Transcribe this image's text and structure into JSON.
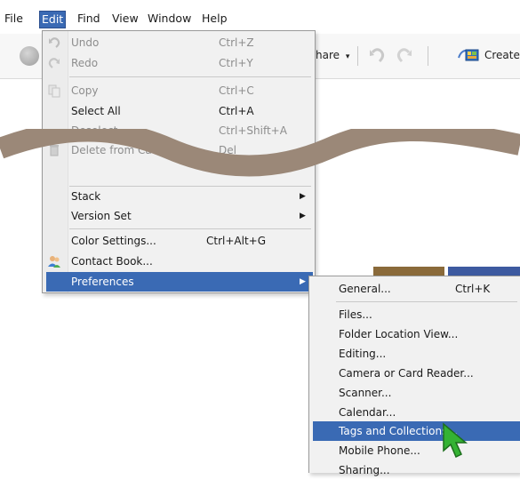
{
  "menubar": {
    "items": [
      "File",
      "Edit",
      "Find",
      "View",
      "Window",
      "Help"
    ],
    "active": "Edit"
  },
  "toolbar": {
    "share_label": "hare",
    "share_arrow": "▾",
    "create_label": "Create"
  },
  "edit_menu": {
    "undo": {
      "label": "Undo",
      "shortcut": "Ctrl+Z"
    },
    "redo": {
      "label": "Redo",
      "shortcut": "Ctrl+Y"
    },
    "copy": {
      "label": "Copy",
      "shortcut": "Ctrl+C"
    },
    "select_all": {
      "label": "Select All",
      "shortcut": "Ctrl+A"
    },
    "deselect": {
      "label": "Deselect",
      "shortcut": "Ctrl+Shift+A"
    },
    "delete": {
      "label": "Delete from Ca",
      "shortcut": "Del"
    },
    "stack": {
      "label": "Stack",
      "arrow": "▶"
    },
    "version_set": {
      "label": "Version Set",
      "arrow": "▶"
    },
    "color_settings": {
      "label": "Color Settings...",
      "shortcut": "Ctrl+Alt+G"
    },
    "contact_book": {
      "label": "Contact Book..."
    },
    "preferences": {
      "label": "Preferences",
      "arrow": "▶"
    }
  },
  "preferences_menu": {
    "general": {
      "label": "General...",
      "shortcut": "Ctrl+K"
    },
    "files": {
      "label": "Files..."
    },
    "folder_location_view": {
      "label": "Folder Location View..."
    },
    "editing": {
      "label": "Editing..."
    },
    "camera_or_card_reader": {
      "label": "Camera or Card Reader..."
    },
    "scanner": {
      "label": "Scanner..."
    },
    "calendar": {
      "label": "Calendar..."
    },
    "tags_and_collections": {
      "label": "Tags and Collections..."
    },
    "mobile_phone": {
      "label": "Mobile Phone..."
    },
    "sharing": {
      "label": "Sharing..."
    }
  },
  "colors": {
    "highlight": "#3a6ab4",
    "squiggle": "#9b8878",
    "cursor": "#34b233"
  },
  "icons": [
    "undo-icon",
    "redo-icon",
    "copy-icon",
    "delete-icon",
    "contact-book-icon",
    "back-nav-icon",
    "create-icon",
    "mouse-pointer-icon"
  ]
}
